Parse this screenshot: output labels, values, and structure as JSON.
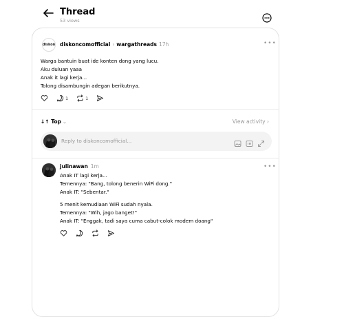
{
  "header": {
    "title": "Thread",
    "views": "53 views"
  },
  "post": {
    "avatar_text": "diskon",
    "author": "diskoncomofficial",
    "separator": "›",
    "reposter": "wargathreads",
    "time": "17h",
    "lines": [
      "Warga bantuin buat ide konten dong yang lucu.",
      "Aku duluan yaaa",
      "Anak it lagi kerja...",
      "Tolong disambungin adegan berikutnya."
    ],
    "reply_count": "1",
    "repost_count": "1"
  },
  "sort": {
    "label": "Top",
    "view_activity": "View activity ›"
  },
  "reply_box": {
    "placeholder": "Reply to diskoncomofficial..."
  },
  "comment": {
    "author": "julinawan",
    "time": "1m",
    "paragraph1": [
      "Anak IT lagi kerja...",
      "Temennya: \"Bang, tolong benerin WiFi dong.\"",
      "Anak IT: \"Sebentar.\""
    ],
    "paragraph2": [
      "5 menit kemudiaan WiFi sudah nyala.",
      "Temennya: \"Wih, jago banget!\"",
      "Anak IT: \"Enggak, tadi saya cuma cabut-colok modem doang\""
    ]
  },
  "icons": {
    "back": "arrow-left-icon",
    "more": "more-circle-icon",
    "like": "heart-icon",
    "reply": "comment-icon",
    "repost": "repost-icon",
    "share": "send-icon"
  }
}
